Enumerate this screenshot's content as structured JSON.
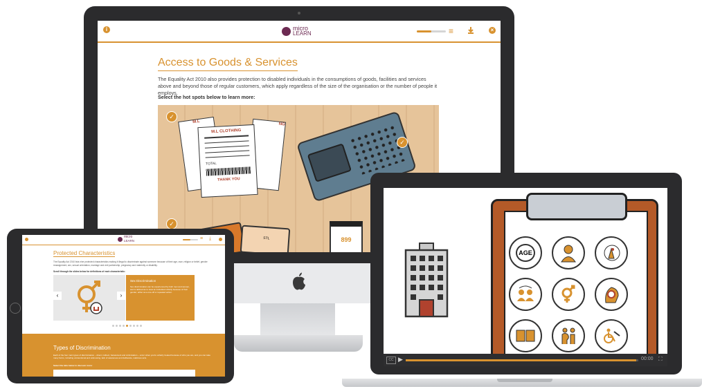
{
  "desktop": {
    "logo": {
      "line1": "micro",
      "line2": "LEARN"
    },
    "header": {
      "progress_fraction": 0.5
    },
    "title": "Access to Goods & Services",
    "paragraph": "The Equality Act 2010 also provides protection to disabled individuals in the consumptions of goods, facilities and services above and beyond those of regular customers, which apply regardless of the size of the organisation or the number of people it employs.",
    "instruction": "Select the hot spots below to learn more:",
    "receipts": {
      "shop": "M.L CLOTHING",
      "shop_short": "M.L",
      "shop_tail": "NG",
      "total": "TOTAL",
      "thanks": "THANK YOU"
    },
    "card_text": "STL",
    "price_tag": "899",
    "colors": {
      "accent": "#d8922f",
      "brand": "#6c2a52",
      "hotspot_bg": "#e6c49a"
    }
  },
  "tablet": {
    "logo": {
      "line1": "micro",
      "line2": "LEARN"
    },
    "header": {
      "progress_fraction": 0.5
    },
    "title": "Protected Characteristics",
    "paragraph": "The Equality Act 2010 lists nine protected characteristics making it illegal to discriminate against someone because of their age, race, religion or belief, gender reassignment, sex, sexual orientation, marriage and civil partnership, pregnancy and maternity or disability.",
    "instruction": "Scroll through the slides below for definitions of each characteristic:",
    "slide": {
      "heading": "Sex Discrimination",
      "text": "Sex discrimination can be experienced by both men and women, and is defined as to treat an individual unfairly because of their gender, either as a one-off or repeated action."
    },
    "dots_total": 9,
    "dots_active": 4,
    "section2": {
      "title": "Types of Discrimination",
      "paragraph": "Each of the four main types of discrimination – direct, indirect, harassment and victimisation – occur when you're unfairly treated because of who you are, and you can take many forms, including unintentional and unknowing, lack of awareness and deliberate, malicious acts.",
      "instruction": "Select the tabs below to discover more:"
    }
  },
  "laptop": {
    "video": {
      "time": "00:00",
      "progress_fraction": 0.99,
      "cc": "CC"
    },
    "characteristics": [
      "age",
      "race",
      "religion",
      "gender-reassignment",
      "sex",
      "sexual-orientation",
      "marriage",
      "pregnancy",
      "disability"
    ],
    "age_label": "AGE"
  }
}
